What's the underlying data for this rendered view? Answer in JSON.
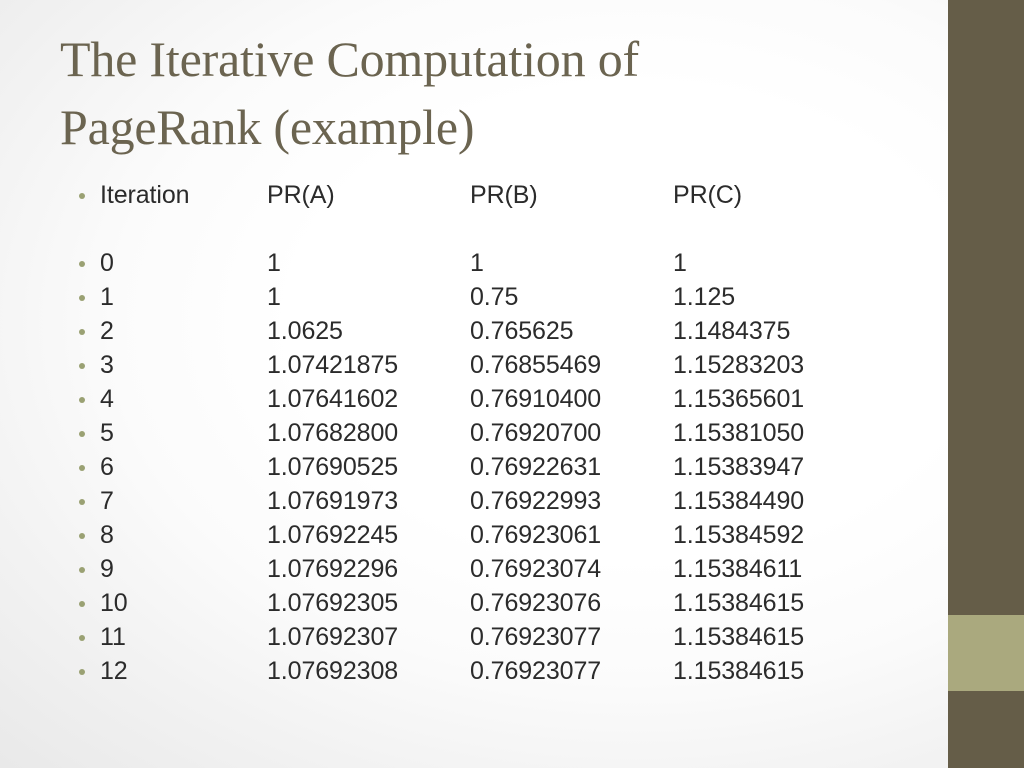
{
  "slide": {
    "title": "The Iterative Computation of\nPageRank (example)",
    "title_color": "#6b6450",
    "body_text_color": "#2b2b2b",
    "bullet_color": "#9aa173",
    "background": "#ffffff"
  },
  "decor": {
    "right_bar_color": "#655d48",
    "right_accent_color": "#aaa97e"
  },
  "table": {
    "headers": [
      "Iteration",
      "PR(A)",
      "PR(B)",
      "PR(C)"
    ],
    "rows": [
      [
        "0",
        "1",
        "1",
        "1"
      ],
      [
        "1",
        "1",
        "0.75",
        "1.125"
      ],
      [
        "2",
        "1.0625",
        "0.765625",
        "1.1484375"
      ],
      [
        "3",
        "1.07421875",
        "0.76855469",
        "1.15283203"
      ],
      [
        "4",
        "1.07641602",
        "0.76910400",
        "1.15365601"
      ],
      [
        "5",
        "1.07682800",
        "0.76920700",
        "1.15381050"
      ],
      [
        "6",
        "1.07690525",
        "0.76922631",
        "1.15383947"
      ],
      [
        "7",
        "1.07691973",
        "0.76922993",
        "1.15384490"
      ],
      [
        "8",
        "1.07692245",
        "0.76923061",
        "1.15384592"
      ],
      [
        "9",
        "1.07692296",
        "0.76923074",
        "1.15384611"
      ],
      [
        "10",
        "1.07692305",
        "0.76923076",
        "1.15384615"
      ],
      [
        "11",
        "1.07692307",
        "0.76923077",
        "1.15384615"
      ],
      [
        "12",
        "1.07692308",
        "0.76923077",
        "1.15384615"
      ]
    ]
  }
}
